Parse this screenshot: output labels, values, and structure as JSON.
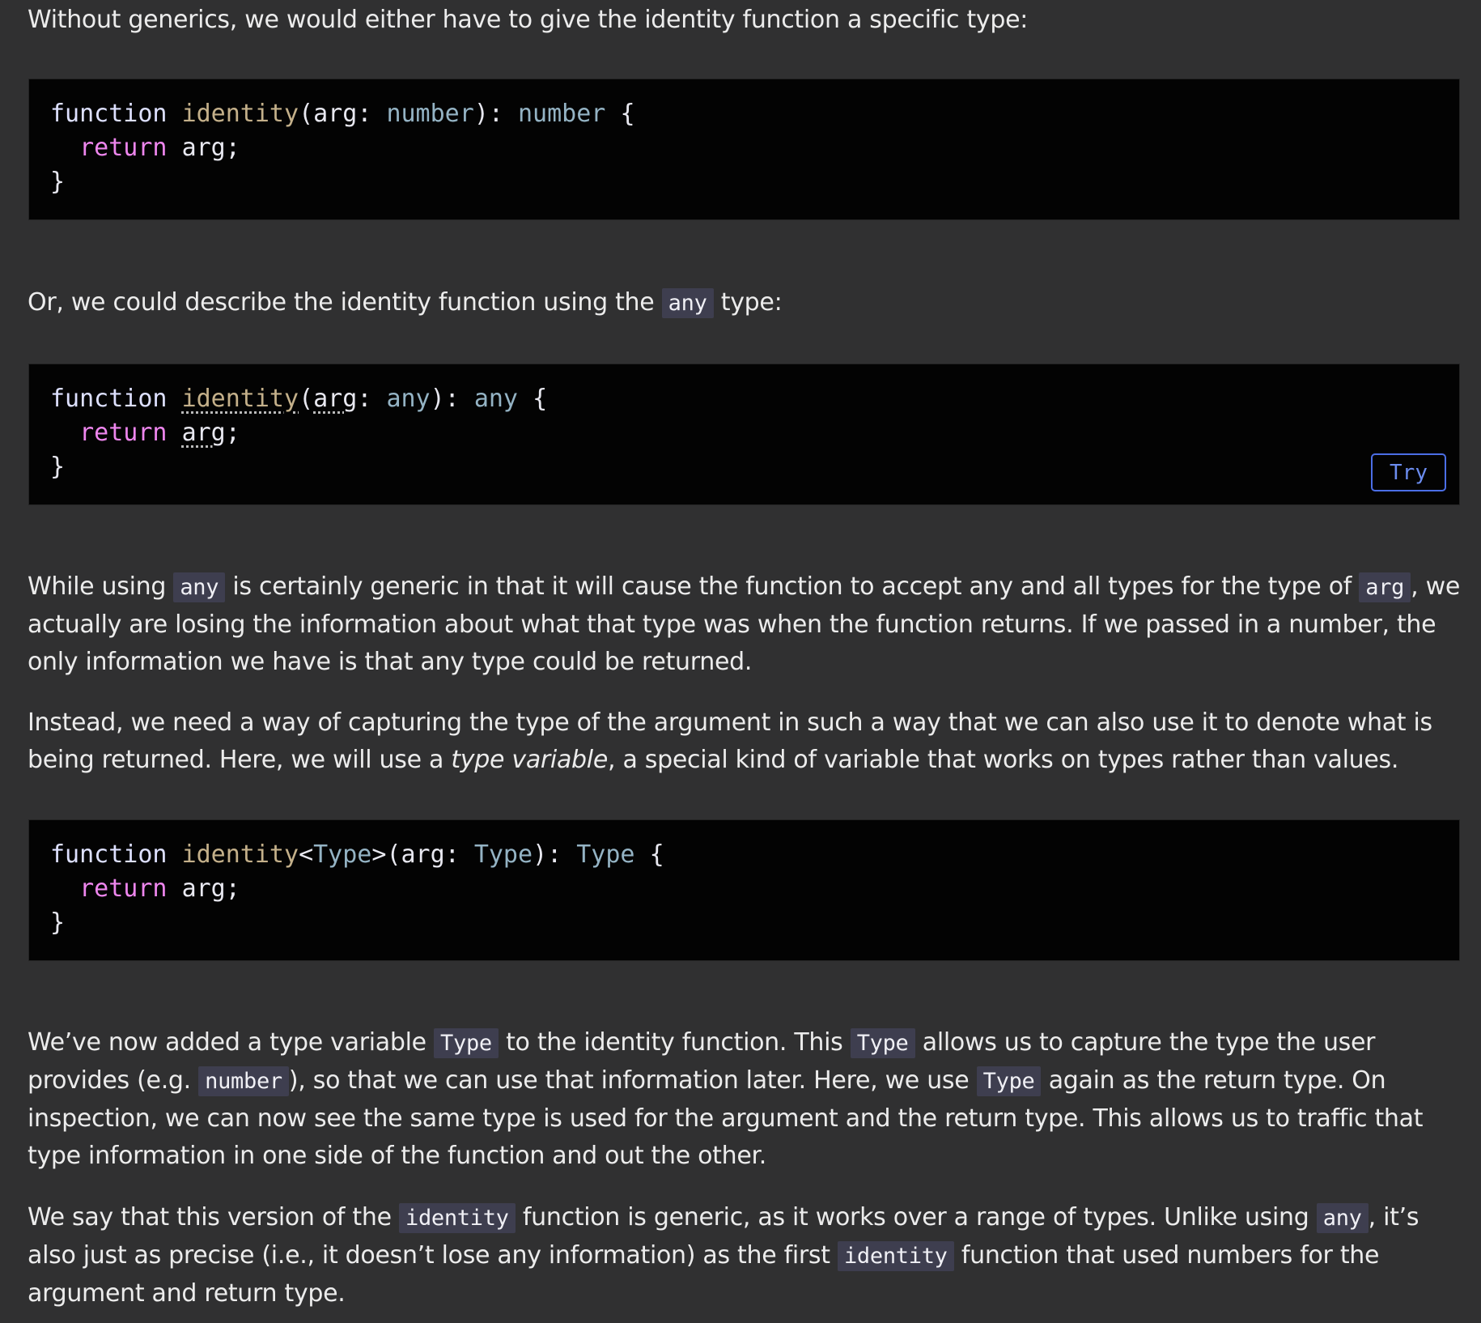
{
  "para1": {
    "text": "Without generics, we would either have to give the identity function a specific type:"
  },
  "para2": {
    "before": "Or, we could describe the identity function using the ",
    "code": "any",
    "after": " type:"
  },
  "para3": {
    "t1": "While using ",
    "c1": "any",
    "t2": " is certainly generic in that it will cause the function to accept any and all types for the type of ",
    "c2": "arg",
    "t3": ", we actually are losing the information about what that type was when the function returns. If we passed in a number, the only information we have is that any type could be returned."
  },
  "para4": {
    "t1": "Instead, we need a way of capturing the type of the argument in such a way that we can also use it to denote what is being returned. Here, we will use a ",
    "em": "type variable",
    "t2": ", a special kind of variable that works on types rather than values."
  },
  "para5": {
    "t1": "We’ve now added a type variable ",
    "c1": "Type",
    "t2": " to the identity function. This ",
    "c2": "Type",
    "t3": " allows us to capture the type the user provides (e.g. ",
    "c3": "number",
    "t4": "), so that we can use that information later. Here, we use ",
    "c4": "Type",
    "t5": " again as the return type. On inspection, we can now see the same type is used for the argument and the return type. This allows us to traffic that type information in one side of the function and out the other."
  },
  "para6": {
    "t1": "We say that this version of the ",
    "c1": "identity",
    "t2": " function is generic, as it works over a range of types. Unlike using ",
    "c2": "any",
    "t3": ", it’s also just as precise (i.e., it doesn’t lose any information) as the first ",
    "c3": "identity",
    "t4": " function that used numbers for the argument and return type."
  },
  "code1": {
    "kw": "function",
    "fn": "identity",
    "p1": "(",
    "arg": "arg",
    "colon": ":",
    "ty1": "number",
    "p2": "):",
    "ty2": "number",
    "brace": "{",
    "ret": "return",
    "retval": "arg;",
    "close": "}"
  },
  "code2": {
    "kw": "function",
    "fn": "identity",
    "p1": "(",
    "arg": "arg",
    "colon": ":",
    "ty1": "any",
    "p2": "):",
    "ty2": "any",
    "brace": "{",
    "ret": "return",
    "retval": "arg",
    "semi": ";",
    "close": "}",
    "try_label": "Try"
  },
  "code3": {
    "kw": "function",
    "fn": "identity",
    "lt": "<",
    "tp": "Type",
    "gt": ">",
    "p1": "(",
    "arg": "arg",
    "colon": ":",
    "ty1": "Type",
    "p2": "):",
    "ty2": "Type",
    "brace": "{",
    "ret": "return",
    "retval": "arg;",
    "close": "}"
  },
  "colors": {
    "background": "#303031",
    "code_bg": "#030303",
    "keyword": "#dde0ff",
    "function": "#c4b08a",
    "type": "#94b3c4",
    "return": "#ee86ee",
    "try_button": "#4b6ee6"
  }
}
